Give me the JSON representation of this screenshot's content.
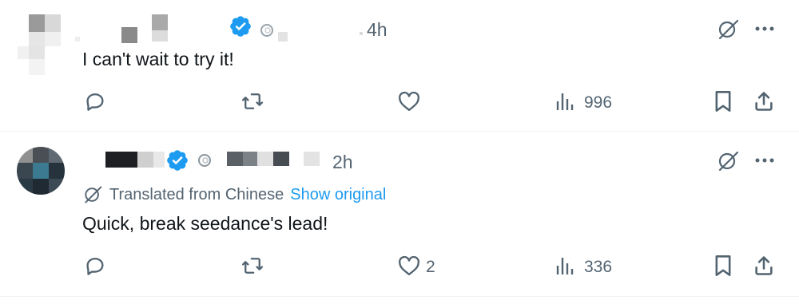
{
  "tweets": [
    {
      "time": "4h",
      "text": "I can't wait to try it!",
      "like_count": "",
      "views": "996"
    },
    {
      "time": "2h",
      "translation_note": "Translated from Chinese",
      "show_original": "Show original",
      "text": "Quick, break seedance's lead!",
      "like_count": "2",
      "views": "336"
    }
  ],
  "colors": {
    "text_primary": "#0f1419",
    "text_secondary": "#536471",
    "accent": "#1d9bf0",
    "divider": "#eff3f4"
  },
  "icons": [
    "verified-badge-icon",
    "at-icon",
    "grok-icon",
    "more-icon",
    "reply-icon",
    "repost-icon",
    "like-icon",
    "views-icon",
    "bookmark-icon",
    "share-icon",
    "translate-icon"
  ]
}
